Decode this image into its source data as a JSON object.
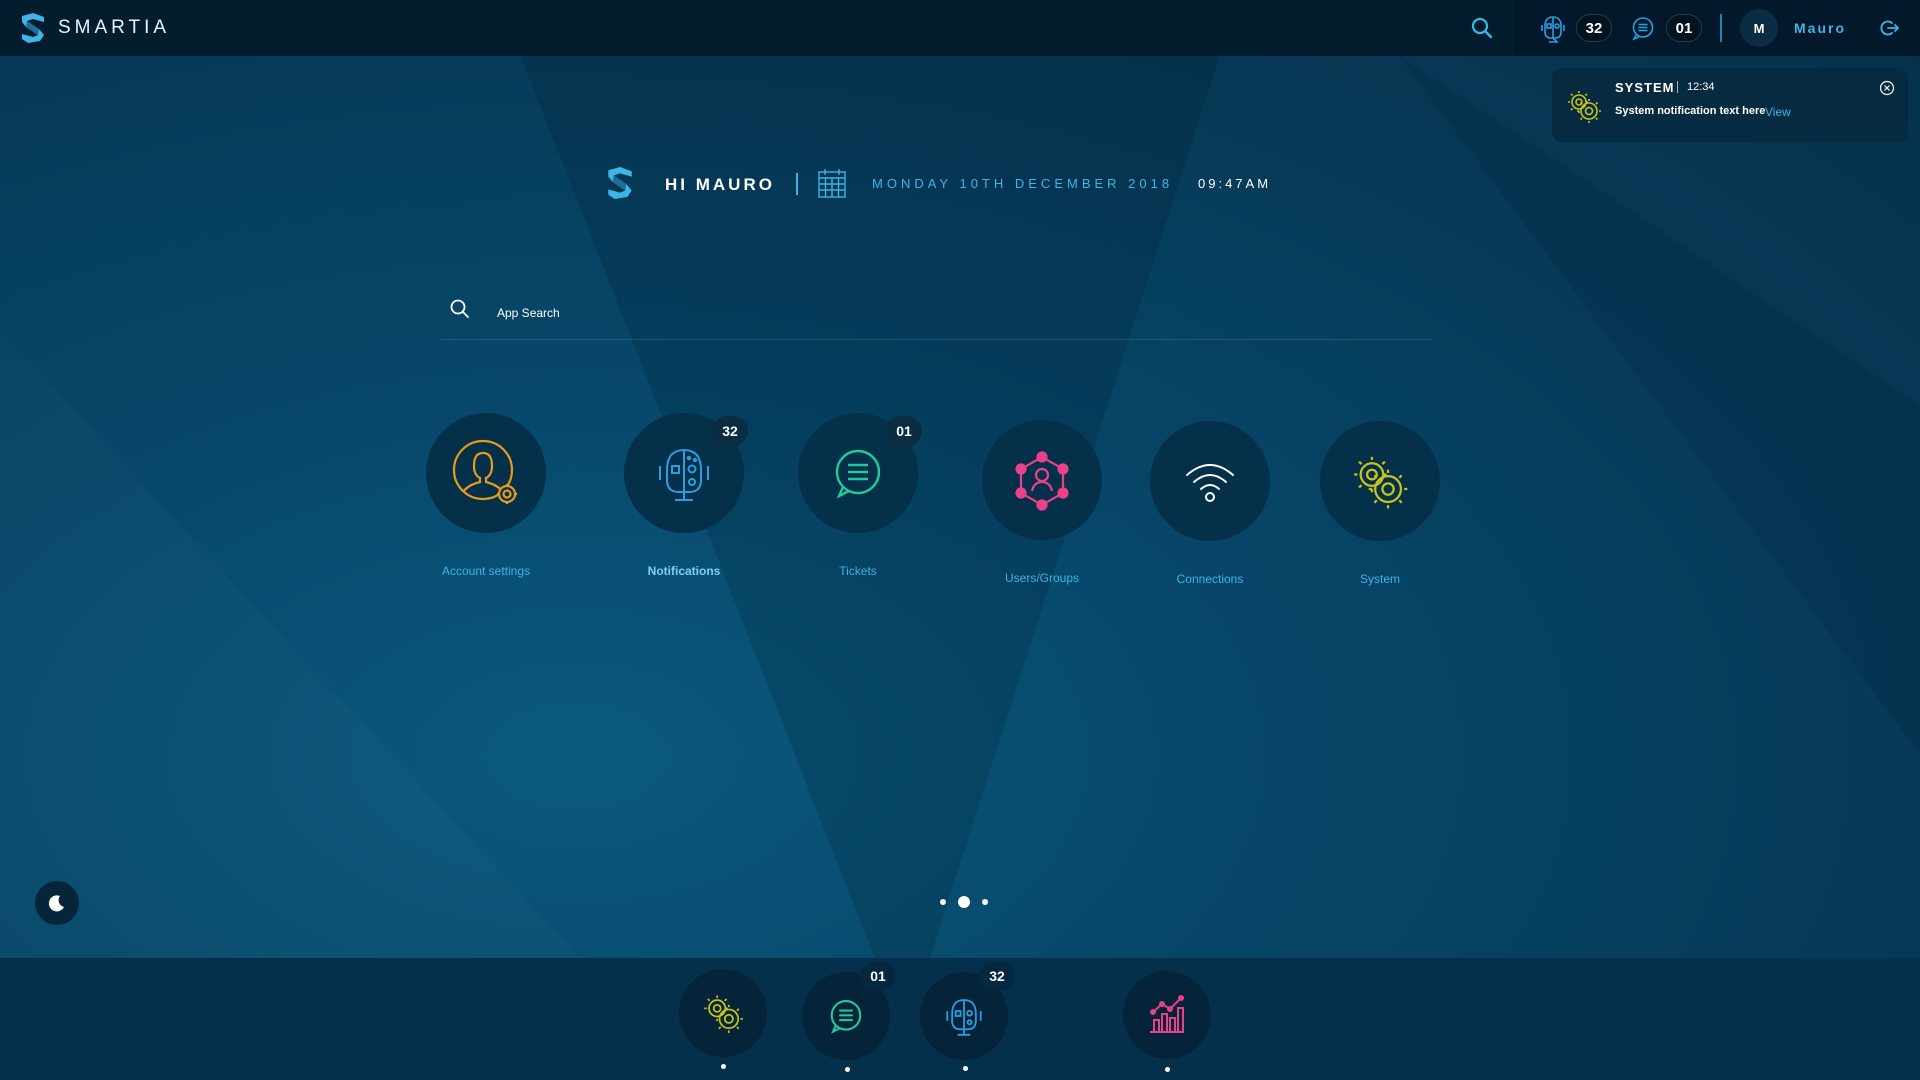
{
  "brand": {
    "name": "SMARTIA"
  },
  "topbar": {
    "notifications_count": "32",
    "tickets_count": "01",
    "user_initial": "M",
    "user_name": "Mauro"
  },
  "toast": {
    "title": "SYSTEM",
    "time": "12:34",
    "text": "System notification text here",
    "view_label": "View"
  },
  "greeting": {
    "hello": "HI MAURO",
    "date": "MONDAY 10TH DECEMBER 2018",
    "time": "09:47AM"
  },
  "search": {
    "placeholder": "App Search"
  },
  "apps": [
    {
      "label": "Account settings",
      "icon": "account-settings-icon",
      "color": "#e89a1c"
    },
    {
      "label": "Notifications",
      "icon": "robot-head-icon",
      "color": "#2a9ee0",
      "badge": "32"
    },
    {
      "label": "Tickets",
      "icon": "chat-bubble-icon",
      "color": "#22c99b",
      "badge": "01"
    },
    {
      "label": "Users/Groups",
      "icon": "users-network-icon",
      "color": "#e9418a"
    },
    {
      "label": "Connections",
      "icon": "wifi-icon",
      "color": "#ffffff"
    },
    {
      "label": "System",
      "icon": "gears-icon",
      "color": "#c8c21e"
    }
  ],
  "pager": {
    "pages": 3,
    "active": 2
  },
  "dock": [
    {
      "icon": "gears-icon",
      "color": "#c8c21e"
    },
    {
      "icon": "chat-bubble-icon",
      "color": "#22c99b",
      "badge": "01"
    },
    {
      "icon": "robot-head-icon",
      "color": "#2a9ee0",
      "badge": "32"
    },
    {
      "icon": "analytics-chart-icon",
      "color": "#e9418a"
    }
  ],
  "colors": {
    "accent": "#3fb4e6",
    "topbar": "#041d2e",
    "background": "#063a57"
  }
}
